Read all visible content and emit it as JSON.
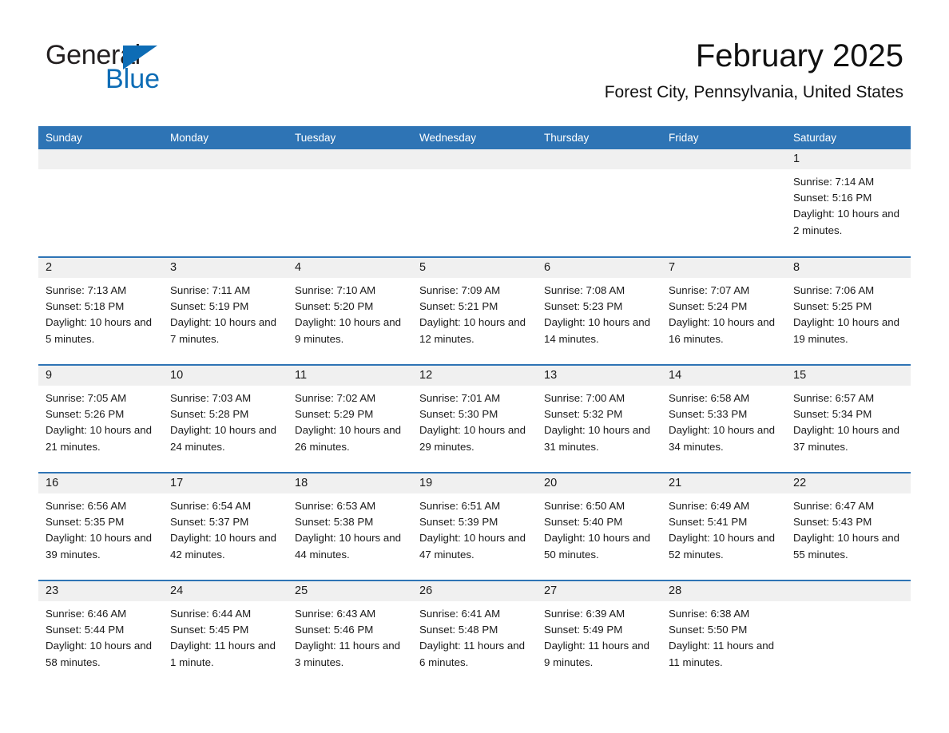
{
  "logo": {
    "word_one": "General",
    "word_two": "Blue",
    "triangle_icon": "triangle-icon",
    "black": "#231f20",
    "blue": "#0d6cb5"
  },
  "header": {
    "title": "February 2025",
    "subtitle": "Forest City, Pennsylvania, United States"
  },
  "theme": {
    "accent": "#2e74b5",
    "daynum_bg": "#f0f0f0",
    "text": "#1a1a1a",
    "page_bg": "#ffffff"
  },
  "calendar": {
    "weekday_headers": [
      "Sunday",
      "Monday",
      "Tuesday",
      "Wednesday",
      "Thursday",
      "Friday",
      "Saturday"
    ],
    "labels": {
      "sunrise": "Sunrise:",
      "sunset": "Sunset:",
      "daylight": "Daylight:"
    },
    "weeks": [
      [
        {
          "day": "",
          "sunrise": "",
          "sunset": "",
          "daylight": ""
        },
        {
          "day": "",
          "sunrise": "",
          "sunset": "",
          "daylight": ""
        },
        {
          "day": "",
          "sunrise": "",
          "sunset": "",
          "daylight": ""
        },
        {
          "day": "",
          "sunrise": "",
          "sunset": "",
          "daylight": ""
        },
        {
          "day": "",
          "sunrise": "",
          "sunset": "",
          "daylight": ""
        },
        {
          "day": "",
          "sunrise": "",
          "sunset": "",
          "daylight": ""
        },
        {
          "day": "1",
          "sunrise": "Sunrise: 7:14 AM",
          "sunset": "Sunset: 5:16 PM",
          "daylight": "Daylight: 10 hours and 2 minutes."
        }
      ],
      [
        {
          "day": "2",
          "sunrise": "Sunrise: 7:13 AM",
          "sunset": "Sunset: 5:18 PM",
          "daylight": "Daylight: 10 hours and 5 minutes."
        },
        {
          "day": "3",
          "sunrise": "Sunrise: 7:11 AM",
          "sunset": "Sunset: 5:19 PM",
          "daylight": "Daylight: 10 hours and 7 minutes."
        },
        {
          "day": "4",
          "sunrise": "Sunrise: 7:10 AM",
          "sunset": "Sunset: 5:20 PM",
          "daylight": "Daylight: 10 hours and 9 minutes."
        },
        {
          "day": "5",
          "sunrise": "Sunrise: 7:09 AM",
          "sunset": "Sunset: 5:21 PM",
          "daylight": "Daylight: 10 hours and 12 minutes."
        },
        {
          "day": "6",
          "sunrise": "Sunrise: 7:08 AM",
          "sunset": "Sunset: 5:23 PM",
          "daylight": "Daylight: 10 hours and 14 minutes."
        },
        {
          "day": "7",
          "sunrise": "Sunrise: 7:07 AM",
          "sunset": "Sunset: 5:24 PM",
          "daylight": "Daylight: 10 hours and 16 minutes."
        },
        {
          "day": "8",
          "sunrise": "Sunrise: 7:06 AM",
          "sunset": "Sunset: 5:25 PM",
          "daylight": "Daylight: 10 hours and 19 minutes."
        }
      ],
      [
        {
          "day": "9",
          "sunrise": "Sunrise: 7:05 AM",
          "sunset": "Sunset: 5:26 PM",
          "daylight": "Daylight: 10 hours and 21 minutes."
        },
        {
          "day": "10",
          "sunrise": "Sunrise: 7:03 AM",
          "sunset": "Sunset: 5:28 PM",
          "daylight": "Daylight: 10 hours and 24 minutes."
        },
        {
          "day": "11",
          "sunrise": "Sunrise: 7:02 AM",
          "sunset": "Sunset: 5:29 PM",
          "daylight": "Daylight: 10 hours and 26 minutes."
        },
        {
          "day": "12",
          "sunrise": "Sunrise: 7:01 AM",
          "sunset": "Sunset: 5:30 PM",
          "daylight": "Daylight: 10 hours and 29 minutes."
        },
        {
          "day": "13",
          "sunrise": "Sunrise: 7:00 AM",
          "sunset": "Sunset: 5:32 PM",
          "daylight": "Daylight: 10 hours and 31 minutes."
        },
        {
          "day": "14",
          "sunrise": "Sunrise: 6:58 AM",
          "sunset": "Sunset: 5:33 PM",
          "daylight": "Daylight: 10 hours and 34 minutes."
        },
        {
          "day": "15",
          "sunrise": "Sunrise: 6:57 AM",
          "sunset": "Sunset: 5:34 PM",
          "daylight": "Daylight: 10 hours and 37 minutes."
        }
      ],
      [
        {
          "day": "16",
          "sunrise": "Sunrise: 6:56 AM",
          "sunset": "Sunset: 5:35 PM",
          "daylight": "Daylight: 10 hours and 39 minutes."
        },
        {
          "day": "17",
          "sunrise": "Sunrise: 6:54 AM",
          "sunset": "Sunset: 5:37 PM",
          "daylight": "Daylight: 10 hours and 42 minutes."
        },
        {
          "day": "18",
          "sunrise": "Sunrise: 6:53 AM",
          "sunset": "Sunset: 5:38 PM",
          "daylight": "Daylight: 10 hours and 44 minutes."
        },
        {
          "day": "19",
          "sunrise": "Sunrise: 6:51 AM",
          "sunset": "Sunset: 5:39 PM",
          "daylight": "Daylight: 10 hours and 47 minutes."
        },
        {
          "day": "20",
          "sunrise": "Sunrise: 6:50 AM",
          "sunset": "Sunset: 5:40 PM",
          "daylight": "Daylight: 10 hours and 50 minutes."
        },
        {
          "day": "21",
          "sunrise": "Sunrise: 6:49 AM",
          "sunset": "Sunset: 5:41 PM",
          "daylight": "Daylight: 10 hours and 52 minutes."
        },
        {
          "day": "22",
          "sunrise": "Sunrise: 6:47 AM",
          "sunset": "Sunset: 5:43 PM",
          "daylight": "Daylight: 10 hours and 55 minutes."
        }
      ],
      [
        {
          "day": "23",
          "sunrise": "Sunrise: 6:46 AM",
          "sunset": "Sunset: 5:44 PM",
          "daylight": "Daylight: 10 hours and 58 minutes."
        },
        {
          "day": "24",
          "sunrise": "Sunrise: 6:44 AM",
          "sunset": "Sunset: 5:45 PM",
          "daylight": "Daylight: 11 hours and 1 minute."
        },
        {
          "day": "25",
          "sunrise": "Sunrise: 6:43 AM",
          "sunset": "Sunset: 5:46 PM",
          "daylight": "Daylight: 11 hours and 3 minutes."
        },
        {
          "day": "26",
          "sunrise": "Sunrise: 6:41 AM",
          "sunset": "Sunset: 5:48 PM",
          "daylight": "Daylight: 11 hours and 6 minutes."
        },
        {
          "day": "27",
          "sunrise": "Sunrise: 6:39 AM",
          "sunset": "Sunset: 5:49 PM",
          "daylight": "Daylight: 11 hours and 9 minutes."
        },
        {
          "day": "28",
          "sunrise": "Sunrise: 6:38 AM",
          "sunset": "Sunset: 5:50 PM",
          "daylight": "Daylight: 11 hours and 11 minutes."
        },
        {
          "day": "",
          "sunrise": "",
          "sunset": "",
          "daylight": ""
        }
      ]
    ]
  }
}
